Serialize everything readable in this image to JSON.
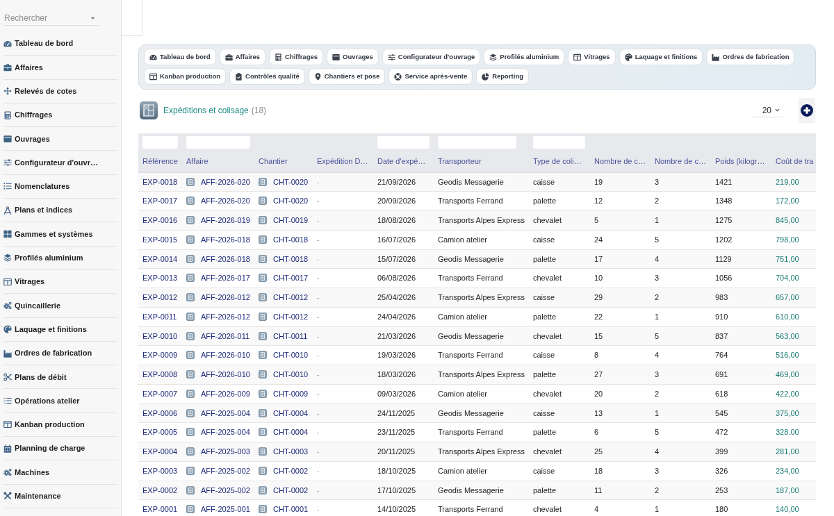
{
  "sidebar": {
    "search": {
      "placeholder": "Rechercher"
    },
    "items": [
      "Tableau de bord",
      "Affaires",
      "Relevés de cotes",
      "Chiffrages",
      "Ouvrages",
      "Configurateur d'ouvr…",
      "Nomenclatures",
      "Plans et indices",
      "Gammes et systèmes",
      "Profilés aluminium",
      "Vitrages",
      "Quincaillerie",
      "Laquage et finitions",
      "Ordres de fabrication",
      "Plans de débit",
      "Opérations atelier",
      "Kanban production",
      "Planning de charge",
      "Machines",
      "Maintenance"
    ]
  },
  "toolbar": {
    "buttons": [
      "Tableau de bord",
      "Affaires",
      "Chiffrages",
      "Ouvrages",
      "Configurateur d'ouvrage",
      "Profilés aluminium",
      "Vitrages",
      "Laquage et finitions",
      "Ordres de fabrication",
      "Kanban production",
      "Contrôles qualité",
      "Chantiers et pose",
      "Service après-vente",
      "Reporting"
    ]
  },
  "header": {
    "title": "Expéditions et colisage",
    "count": "(18)",
    "page_size": "20"
  },
  "table": {
    "columns": [
      {
        "label": "Référence",
        "kind": "link",
        "filter": true
      },
      {
        "label": "Affaire",
        "kind": "icon_link",
        "filter": true
      },
      {
        "label": "Chantier",
        "kind": "icon_link",
        "filter": false
      },
      {
        "label": "Expédition D…",
        "kind": "muted",
        "filter": false
      },
      {
        "label": "Date d'expé…",
        "kind": "text",
        "filter": true
      },
      {
        "label": "Transporteur",
        "kind": "text",
        "filter": true
      },
      {
        "label": "Type de coli…",
        "kind": "text",
        "filter": true
      },
      {
        "label": "Nombre de c…",
        "kind": "text",
        "filter": false
      },
      {
        "label": "Nombre de c…",
        "kind": "text",
        "filter": false
      },
      {
        "label": "Poids (kilogr…",
        "kind": "text",
        "filter": false
      },
      {
        "label": "Coût de tra",
        "kind": "money",
        "filter": false
      }
    ],
    "rows": [
      [
        "EXP-0018",
        "AFF-2026-020",
        "CHT-0020",
        "-",
        "21/09/2026",
        "Geodis Messagerie",
        "caisse",
        "19",
        "3",
        "1421",
        "219,00"
      ],
      [
        "EXP-0017",
        "AFF-2026-020",
        "CHT-0020",
        "-",
        "20/09/2026",
        "Transports Ferrand",
        "palette",
        "12",
        "2",
        "1348",
        "172,00"
      ],
      [
        "EXP-0016",
        "AFF-2026-019",
        "CHT-0019",
        "-",
        "18/08/2026",
        "Transports Alpes Express",
        "chevalet",
        "5",
        "1",
        "1275",
        "845,00"
      ],
      [
        "EXP-0015",
        "AFF-2026-018",
        "CHT-0018",
        "-",
        "16/07/2026",
        "Camion atelier",
        "caisse",
        "24",
        "5",
        "1202",
        "798,00"
      ],
      [
        "EXP-0014",
        "AFF-2026-018",
        "CHT-0018",
        "-",
        "15/07/2026",
        "Geodis Messagerie",
        "palette",
        "17",
        "4",
        "1129",
        "751,00"
      ],
      [
        "EXP-0013",
        "AFF-2026-017",
        "CHT-0017",
        "-",
        "06/08/2026",
        "Transports Ferrand",
        "chevalet",
        "10",
        "3",
        "1056",
        "704,00"
      ],
      [
        "EXP-0012",
        "AFF-2026-012",
        "CHT-0012",
        "-",
        "25/04/2026",
        "Transports Alpes Express",
        "caisse",
        "29",
        "2",
        "983",
        "657,00"
      ],
      [
        "EXP-0011",
        "AFF-2026-012",
        "CHT-0012",
        "-",
        "24/04/2026",
        "Camion atelier",
        "palette",
        "22",
        "1",
        "910",
        "610,00"
      ],
      [
        "EXP-0010",
        "AFF-2026-011",
        "CHT-0011",
        "-",
        "21/03/2026",
        "Geodis Messagerie",
        "chevalet",
        "15",
        "5",
        "837",
        "563,00"
      ],
      [
        "EXP-0009",
        "AFF-2026-010",
        "CHT-0010",
        "-",
        "19/03/2026",
        "Transports Ferrand",
        "caisse",
        "8",
        "4",
        "764",
        "516,00"
      ],
      [
        "EXP-0008",
        "AFF-2026-010",
        "CHT-0010",
        "-",
        "18/03/2026",
        "Transports Alpes Express",
        "palette",
        "27",
        "3",
        "691",
        "469,00"
      ],
      [
        "EXP-0007",
        "AFF-2026-009",
        "CHT-0009",
        "-",
        "09/03/2026",
        "Camion atelier",
        "chevalet",
        "20",
        "2",
        "618",
        "422,00"
      ],
      [
        "EXP-0006",
        "AFF-2025-004",
        "CHT-0004",
        "-",
        "24/11/2025",
        "Geodis Messagerie",
        "caisse",
        "13",
        "1",
        "545",
        "375,00"
      ],
      [
        "EXP-0005",
        "AFF-2025-004",
        "CHT-0004",
        "-",
        "23/11/2025",
        "Transports Ferrand",
        "palette",
        "6",
        "5",
        "472",
        "328,00"
      ],
      [
        "EXP-0004",
        "AFF-2025-003",
        "CHT-0003",
        "-",
        "20/11/2025",
        "Transports Alpes Express",
        "chevalet",
        "25",
        "4",
        "399",
        "281,00"
      ],
      [
        "EXP-0003",
        "AFF-2025-002",
        "CHT-0002",
        "-",
        "18/10/2025",
        "Camion atelier",
        "caisse",
        "18",
        "3",
        "326",
        "234,00"
      ],
      [
        "EXP-0002",
        "AFF-2025-002",
        "CHT-0002",
        "-",
        "17/10/2025",
        "Geodis Messagerie",
        "palette",
        "11",
        "2",
        "253",
        "187,00"
      ],
      [
        "EXP-0001",
        "AFF-2025-001",
        "CHT-0001",
        "-",
        "14/10/2025",
        "Transports Ferrand",
        "chevalet",
        "4",
        "1",
        "180",
        "140,00"
      ]
    ]
  }
}
